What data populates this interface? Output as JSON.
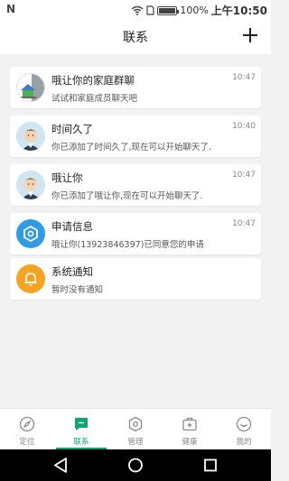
{
  "status_bar": {
    "left_glyph": "N",
    "battery": "100%",
    "battery_level": 1.0,
    "time": "上午10:50",
    "icons": [
      "wifi-icon",
      "sim-card-icon",
      "battery-icon"
    ]
  },
  "header": {
    "title": "联系",
    "add_icon": "plus-icon"
  },
  "conversations": [
    {
      "title": "哦让你的家庭群聊",
      "subtitle": "试试和家庭成员聊天吧",
      "time": "10:47",
      "avatar": "group-avatar"
    },
    {
      "title": "时间久了",
      "subtitle": "你已添加了时间久了,现在可以开始聊天了.",
      "time": "10:40",
      "avatar": "person-avatar"
    },
    {
      "title": "哦让你",
      "subtitle": "你已添加了哦让你,现在可以开始聊天了.",
      "time": "10:47",
      "avatar": "person-avatar"
    },
    {
      "title": "申请信息",
      "subtitle": "哦让你(13923846397)已同意您的申请",
      "time": "10:47",
      "avatar": "request-icon"
    },
    {
      "title": "系统通知",
      "subtitle": "暂时没有通知",
      "time": "",
      "avatar": "bell-icon"
    }
  ],
  "tabs": [
    {
      "label": "定位",
      "icon": "compass-icon",
      "active": false
    },
    {
      "label": "联系",
      "icon": "chat-icon",
      "active": true
    },
    {
      "label": "管理",
      "icon": "shield-icon",
      "active": false
    },
    {
      "label": "健康",
      "icon": "medical-kit-icon",
      "active": false
    },
    {
      "label": "我的",
      "icon": "smile-icon",
      "active": false
    }
  ],
  "colors": {
    "accent": "#12a36f",
    "info_blue": "#2f9ae6",
    "notice_orange": "#f3a423"
  },
  "nav_bar": {
    "icons": [
      "back-icon",
      "home-icon",
      "recents-icon"
    ]
  }
}
